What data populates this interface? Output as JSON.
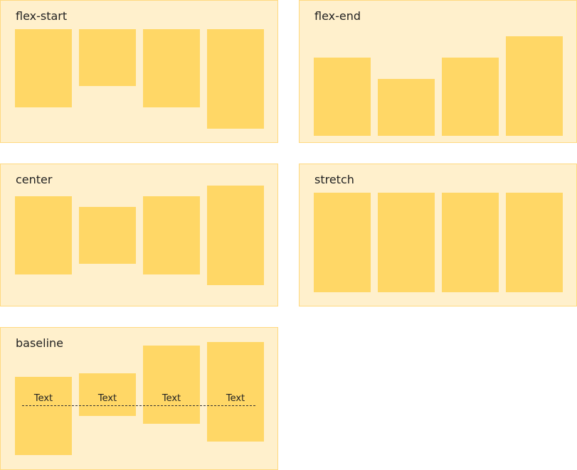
{
  "panels": {
    "flex_start": {
      "label": "flex-start"
    },
    "flex_end": {
      "label": "flex-end"
    },
    "center": {
      "label": "center"
    },
    "stretch": {
      "label": "stretch"
    },
    "baseline": {
      "label": "baseline",
      "item_text": [
        "Text",
        "Text",
        "Text",
        "Text"
      ]
    }
  },
  "colors": {
    "panel_background": "#fff0cc",
    "panel_border": "#ffd980",
    "item_fill": "#ffd766",
    "label_text": "#222222",
    "baseline_line": "#333333"
  }
}
